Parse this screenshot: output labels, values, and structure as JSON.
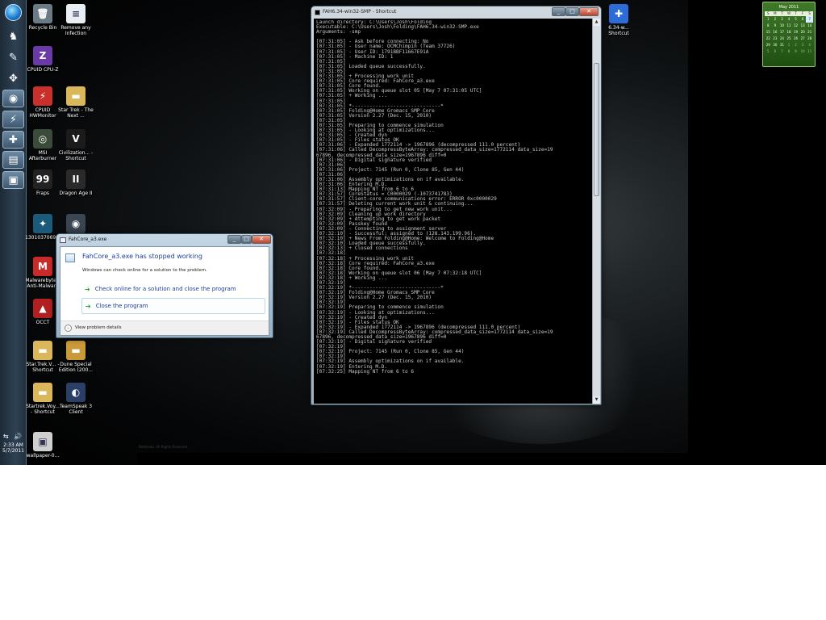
{
  "desktop": {
    "wallpaper_credit": "Bethesda. All Rights Reserved.",
    "icons": [
      {
        "label": "Recycle Bin",
        "icon": "recycle-bin-icon",
        "glyph": "🗑",
        "bg": "#6b7b86"
      },
      {
        "label": "Remove any Infection",
        "icon": "document-icon",
        "glyph": "≡",
        "bg": "#e9eef3"
      },
      {
        "label": "CPUID CPU-Z",
        "icon": "cpuz-icon",
        "glyph": "Z",
        "bg": "#6a3aa6"
      },
      {
        "label": "CPUID HWMonitor",
        "icon": "hwmonitor-icon",
        "glyph": "⚡",
        "bg": "#c9302c"
      },
      {
        "label": "Star Trek - The Next ...",
        "icon": "folder-icon",
        "glyph": "▬",
        "bg": "#d9b75a"
      },
      {
        "label": "MSI Afterburner",
        "icon": "afterburner-icon",
        "glyph": "◎",
        "bg": "#3b4b3a"
      },
      {
        "label": "Civilization... - Shortcut",
        "icon": "civilization-icon",
        "glyph": "V",
        "bg": "#1b1b1b"
      },
      {
        "label": "Fraps",
        "icon": "fraps-icon",
        "glyph": "99",
        "bg": "#222"
      },
      {
        "label": "Dragon Age II",
        "icon": "dragon-age-icon",
        "glyph": "II",
        "bg": "#2a2a2a"
      },
      {
        "label": "1301037069...",
        "icon": "image-icon",
        "glyph": "✦",
        "bg": "#1a5a7a"
      },
      {
        "label": "",
        "icon": "steam-icon",
        "glyph": "◉",
        "bg": "#3a4552"
      },
      {
        "label": "Malwarebytes' Anti-Malware",
        "icon": "malwarebytes-icon",
        "glyph": "M",
        "bg": "#c92a2a"
      },
      {
        "label": "OCCT",
        "icon": "occt-icon",
        "glyph": "▲",
        "bg": "#b02020"
      },
      {
        "label": "Star.Trek.V... - Shortcut",
        "icon": "folder-icon",
        "glyph": "▬",
        "bg": "#d9b75a"
      },
      {
        "label": "Dune Special Edition (200...",
        "icon": "folder-icon",
        "glyph": "▬",
        "bg": "#c99a3a"
      },
      {
        "label": "Startrek.Voy... - Shortcut",
        "icon": "folder-icon",
        "glyph": "▬",
        "bg": "#d9b75a"
      },
      {
        "label": "TeamSpeak 3 Client",
        "icon": "teamspeak-icon",
        "glyph": "◐",
        "bg": "#2b3f66"
      },
      {
        "label": "wallpaper-0...",
        "icon": "image-icon",
        "glyph": "▣",
        "bg": "#cfcfcf"
      },
      {
        "label": "6.34-w... Shortcut",
        "icon": "fah-shortcut-icon",
        "glyph": "✚",
        "bg": "#2d6bd6"
      }
    ]
  },
  "taskbar": {
    "items": [
      "start-orb",
      "media-icon",
      "notepad-icon",
      "gamepad-icon",
      "chrome-icon",
      "hwmonitor-icon",
      "folding-icon",
      "console-icon"
    ],
    "tray_icons": "⇆ 🔊",
    "time": "2:33 AM",
    "date": "5/7/2011"
  },
  "calendar": {
    "title": "May 2011",
    "days": [
      "S",
      "M",
      "T",
      "W",
      "T",
      "F",
      "S"
    ],
    "cells": [
      "1",
      "2",
      "3",
      "4",
      "5",
      "6",
      "7",
      "8",
      "9",
      "10",
      "11",
      "12",
      "13",
      "14",
      "15",
      "16",
      "17",
      "18",
      "19",
      "20",
      "21",
      "22",
      "23",
      "24",
      "25",
      "26",
      "27",
      "28",
      "29",
      "30",
      "31",
      "1",
      "2",
      "3",
      "4",
      "5",
      "6",
      "7",
      "8",
      "9",
      "10",
      "11"
    ],
    "today_index": 6
  },
  "console": {
    "title": "FAH6.34-win32-SMP - Shortcut",
    "lines": [
      "Launch directory: C:\\Users\\Josh\\Folding",
      "Executable: C:\\Users\\Josh\\Folding\\FAH6.34-win32-SMP.exe",
      "Arguments: -smp",
      "",
      "[07:31:05] - Ask before connecting: No",
      "[07:31:05] - User name: OCMChimpin (Team 37726)",
      "[07:31:05] - User ID: 1791BBF11667E91A",
      "[07:31:05] - Machine ID: 1",
      "[07:31:05]",
      "[07:31:05] Loaded queue successfully.",
      "[07:31:05]",
      "[07:31:05] + Processing work unit",
      "[07:31:05] Core required: FahCore_a3.exe",
      "[07:31:05] Core found.",
      "[07:31:05] Working on queue slot 05 [May 7 07:31:05 UTC]",
      "[07:31:05] + Working ...",
      "[07:31:05]",
      "[07:31:05] *------------------------------*",
      "[07:31:05] Folding@Home Gromacs SMP Core",
      "[07:31:05] Version 2.27 (Dec. 15, 2010)",
      "[07:31:05]",
      "[07:31:05] Preparing to commence simulation",
      "[07:31:05] - Looking at optimizations...",
      "[07:31:05] - Created dyn",
      "[07:31:05] - Files status OK",
      "[07:31:06] - Expanded 1772114 -> 1967896 (decompressed 111.0 percent)",
      "[07:31:06] Called DecompressByteArray: compressed_data_size=1772114 data_size=19",
      "67896, decompressed_data_size=1967896 diff=0",
      "[07:31:06] - Digital signature verified",
      "[07:31:06]",
      "[07:31:06] Project: 7145 (Run 0, Clone 85, Gen 44)",
      "[07:31:06]",
      "[07:31:06] Assembly optimizations on if available.",
      "[07:31:06] Entering M.D.",
      "[07:31:13] Mapping NT from 6 to 6",
      "[07:31:57] CoreStatus = C0000029 (-1073741783)",
      "[07:31:57] Client-core communications error: ERROR 0xc0000029",
      "[07:31:57] Deleting current work unit & continuing...",
      "[07:32:09] - Preparing to get new work unit...",
      "[07:32:09] Cleaning up work directory",
      "[07:32:09] + Attempting to get work packet",
      "[07:32:09] Passkey found",
      "[07:32:09] - Connecting to assignment server",
      "[07:32:10] - Successful: assigned to (128.143.199.96).",
      "[07:32:10] + News From Folding@Home: Welcome to Folding@Home",
      "[07:32:10] Loaded queue successfully.",
      "[07:32:13] + Closed connections",
      "[07:32:18]",
      "[07:32:18] + Processing work unit",
      "[07:32:18] Core required: FahCore_a3.exe",
      "[07:32:18] Core found.",
      "[07:32:18] Working on queue slot 06 [May 7 07:32:18 UTC]",
      "[07:32:18] + Working ...",
      "[07:32:19]",
      "[07:32:19] *------------------------------*",
      "[07:32:19] Folding@Home Gromacs SMP Core",
      "[07:32:19] Version 2.27 (Dec. 15, 2010)",
      "[07:32:19]",
      "[07:32:19] Preparing to commence simulation",
      "[07:32:19] - Looking at optimizations...",
      "[07:32:19] - Created dyn",
      "[07:32:19] - Files status OK",
      "[07:32:19] - Expanded 1772114 -> 1967896 (decompressed 111.0 percent)",
      "[07:32:19] Called DecompressByteArray: compressed_data_size=1772114 data_size=19",
      "67896, decompressed_data_size=1967896 diff=0",
      "[07:32:19] - Digital signature verified",
      "[07:32:19]",
      "[07:32:19] Project: 7145 (Run 0, Clone 85, Gen 44)",
      "[07:32:19]",
      "[07:32:19] Assembly optimizations on if available.",
      "[07:32:19] Entering M.D.",
      "[07:32:25] Mapping NT from 6 to 6"
    ]
  },
  "dialog": {
    "title": "FahCore_a3.exe",
    "heading": "FahCore_a3.exe has stopped working",
    "subtext": "Windows can check online for a solution to the problem.",
    "option_check": "Check online for a solution and close the program",
    "option_close": "Close the program",
    "details": "View problem details"
  },
  "colors": {
    "dialog_link": "#1e3f9c",
    "console_text": "#c8c8c8"
  }
}
